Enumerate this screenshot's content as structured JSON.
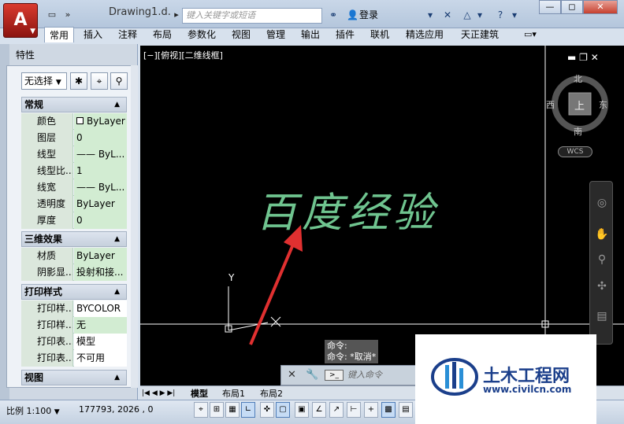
{
  "titlebar": {
    "doc_title": "Drawing1.d...",
    "search_placeholder": "键入关键字或短语",
    "login": "登录",
    "close_label": "✕",
    "restore_label": "◻",
    "minimize_label": "—"
  },
  "ribbon": {
    "tabs": [
      "常用",
      "插入",
      "注释",
      "布局",
      "参数化",
      "视图",
      "管理",
      "输出",
      "插件",
      "联机",
      "精选应用",
      "天正建筑"
    ]
  },
  "palette": {
    "title": "特性",
    "selection": "无选择",
    "sections": {
      "general": "常规",
      "effects3d": "三维效果",
      "plot": "打印样式",
      "view": "视图"
    },
    "general_rows": [
      {
        "name": "颜色",
        "value": "ByLayer"
      },
      {
        "name": "图层",
        "value": "0"
      },
      {
        "name": "线型",
        "value": "—— ByL..."
      },
      {
        "name": "线型比...",
        "value": "1"
      },
      {
        "name": "线宽",
        "value": "—— ByL..."
      },
      {
        "name": "透明度",
        "value": "ByLayer"
      },
      {
        "name": "厚度",
        "value": "0"
      }
    ],
    "effects_rows": [
      {
        "name": "材质",
        "value": "ByLayer"
      },
      {
        "name": "阴影显...",
        "value": "投射和接..."
      }
    ],
    "plot_rows": [
      {
        "name": "打印样...",
        "value": "BYCOLOR"
      },
      {
        "name": "打印样...",
        "value": "无"
      },
      {
        "name": "打印表...",
        "value": "模型"
      },
      {
        "name": "打印表...",
        "value": "不可用"
      }
    ]
  },
  "viewport": {
    "label": "[−][俯视][二维线框]",
    "compass": {
      "n": "北",
      "s": "南",
      "e": "东",
      "w": "西",
      "top": "上"
    },
    "wcs": "WCS",
    "ucs_y": "Y"
  },
  "canvas_text": "百度经验",
  "command": {
    "history_1": "命令:",
    "history_2": "命令: *取消*",
    "placeholder": "键入命令"
  },
  "layout_tabs": [
    "模型",
    "布局1",
    "布局2"
  ],
  "status": {
    "scale": "比例 1:100",
    "coords": "177793, 2026 , 0"
  },
  "watermark": {
    "name": "土木工程网",
    "url": "www.civilcn.com"
  },
  "colors": {
    "canvas": "#000000",
    "text_green": "#6fc48f",
    "arrow_red": "#e03030",
    "brand_blue": "#1b3f8b"
  }
}
